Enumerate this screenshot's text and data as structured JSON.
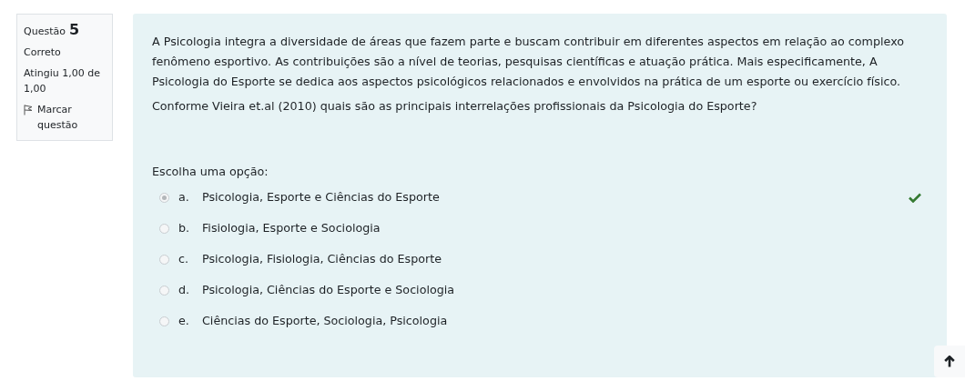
{
  "info": {
    "label": "Questão",
    "number": "5",
    "status": "Correto",
    "grade": "Atingiu 1,00 de 1,00",
    "flag": "Marcar questão",
    "flagged": false
  },
  "question": {
    "paragraphs": [
      "A Psicologia integra a diversidade de áreas que fazem parte e buscam contribuir em diferentes aspectos em relação ao complexo fenômeno esportivo. As contribuições são a nível de teorias, pesquisas científicas e atuação prática. Mais especificamente, A Psicologia do Esporte se dedica aos aspectos psicológicos relacionados e envolvidos na prática de um esporte ou exercício físico.",
      "Conforme Vieira et.al (2010) quais são as principais interrelações profissionais da Psicologia do Esporte?"
    ],
    "prompt": "Escolha uma opção:",
    "options": [
      {
        "letter": "a.",
        "text": "Psicologia, Esporte e Ciências do Esporte",
        "selected": true,
        "correct": true
      },
      {
        "letter": "b.",
        "text": "Fisiologia, Esporte e Sociologia",
        "selected": false,
        "correct": false
      },
      {
        "letter": "c.",
        "text": "Psicologia, Fisiologia, Ciências do Esporte",
        "selected": false,
        "correct": false
      },
      {
        "letter": "d.",
        "text": "Psicologia, Ciências do Esporte e Sociologia",
        "selected": false,
        "correct": false
      },
      {
        "letter": "e.",
        "text": "Ciências do Esporte, Sociologia, Psicologia",
        "selected": false,
        "correct": false
      }
    ]
  }
}
